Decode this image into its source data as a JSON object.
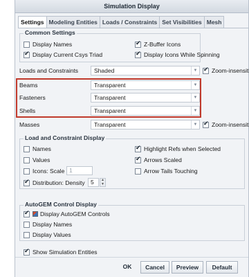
{
  "window": {
    "title": "Simulation Display"
  },
  "tabs": [
    "Settings",
    "Modeling Entities",
    "Loads / Constraints",
    "Set Visibilities",
    "Mesh"
  ],
  "common_settings": {
    "heading": "Common Settings",
    "display_names": {
      "label": "Display Names",
      "checked": false
    },
    "zbuffer": {
      "label": "Z-Buffer Icons",
      "checked": true
    },
    "csys_triad": {
      "label": "Display Current Csys Triad",
      "checked": true
    },
    "icons_spinning": {
      "label": "Display Icons While Spinning",
      "checked": true
    }
  },
  "display_rows": [
    {
      "label": "Loads and Constraints",
      "value": "Shaded",
      "zoom_label": "Zoom-insensitive",
      "zoom_checked": true
    },
    {
      "label": "Beams",
      "value": "Transparent"
    },
    {
      "label": "Fasteners",
      "value": "Transparent"
    },
    {
      "label": "Shells",
      "value": "Transparent"
    },
    {
      "label": "Masses",
      "value": "Transparent",
      "zoom_label": "Zoom-insensitive",
      "zoom_checked": true
    }
  ],
  "load_constraint_display": {
    "heading": "Load and Constraint Display",
    "names": {
      "label": "Names",
      "checked": false
    },
    "values": {
      "label": "Values",
      "checked": false
    },
    "icons_scale": {
      "label": "Icons: Scale",
      "value": "1",
      "checked": false
    },
    "distribution": {
      "label": "Distribution: Density",
      "value": "5",
      "checked": true
    },
    "highlight_refs": {
      "label": "Highlight Refs when Selected",
      "checked": true
    },
    "arrows_scaled": {
      "label": "Arrows Scaled",
      "checked": true
    },
    "arrow_tails": {
      "label": "Arrow Tails Touching",
      "checked": false
    }
  },
  "autogem": {
    "heading": "AutoGEM Control Display",
    "controls": {
      "label": "Display AutoGEM Controls",
      "checked": true
    },
    "names": {
      "label": "Display Names",
      "checked": false
    },
    "values": {
      "label": "Display Values",
      "checked": false
    }
  },
  "show_sim_entities": {
    "label": "Show Simulation Entities",
    "checked": true
  },
  "buttons": {
    "ok": "OK",
    "cancel": "Cancel",
    "preview": "Preview",
    "default": "Default"
  }
}
